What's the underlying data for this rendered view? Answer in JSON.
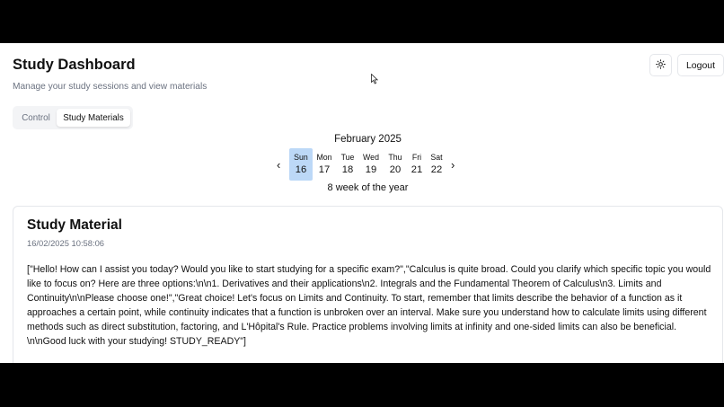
{
  "header": {
    "title": "Study Dashboard",
    "subtitle": "Manage your study sessions and view materials",
    "logout_label": "Logout"
  },
  "tabs": [
    {
      "label": "Control",
      "active": false
    },
    {
      "label": "Study Materials",
      "active": true
    }
  ],
  "calendar": {
    "month": "February 2025",
    "prev_glyph": "‹",
    "next_glyph": "›",
    "days": [
      {
        "name": "Sun",
        "num": "16",
        "selected": true
      },
      {
        "name": "Mon",
        "num": "17",
        "selected": false
      },
      {
        "name": "Tue",
        "num": "18",
        "selected": false
      },
      {
        "name": "Wed",
        "num": "19",
        "selected": false
      },
      {
        "name": "Thu",
        "num": "20",
        "selected": false
      },
      {
        "name": "Fri",
        "num": "21",
        "selected": false
      },
      {
        "name": "Sat",
        "num": "22",
        "selected": false
      }
    ],
    "week_label": "8 week of the year"
  },
  "material": {
    "title": "Study Material",
    "timestamp": "16/02/2025 10:58:06",
    "body": "[\"Hello! How can I assist you today? Would you like to start studying for a specific exam?\",\"Calculus is quite broad. Could you clarify which specific topic you would like to focus on? Here are three options:\\n\\n1. Derivatives and their applications\\n2. Integrals and the Fundamental Theorem of Calculus\\n3. Limits and Continuity\\n\\nPlease choose one!\",\"Great choice! Let's focus on Limits and Continuity. To start, remember that limits describe the behavior of a function as it approaches a certain point, while continuity indicates that a function is unbroken over an interval. Make sure you understand how to calculate limits using different methods such as direct substitution, factoring, and L'Hôpital's Rule. Practice problems involving limits at infinity and one-sided limits can also be beneficial. \\n\\nGood luck with your studying! STUDY_READY\"]"
  },
  "icons": {
    "theme": "sun-icon",
    "cursor": "mouse-pointer-icon"
  },
  "colors": {
    "selected_day": "#bcd8f7",
    "muted_text": "#6b7280",
    "border": "#e5e7eb"
  }
}
